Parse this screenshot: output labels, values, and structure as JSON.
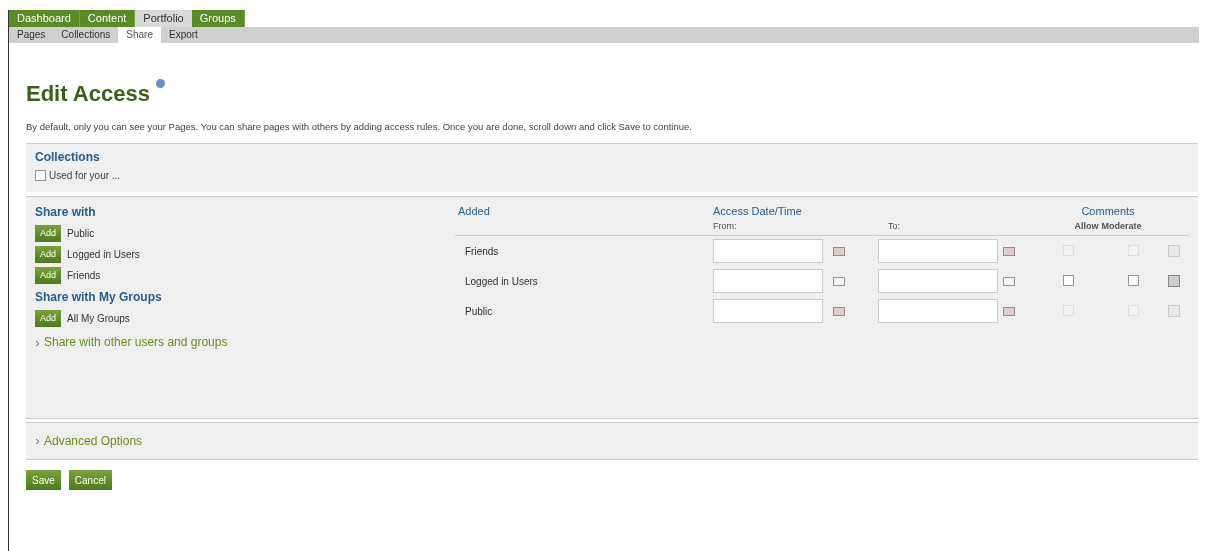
{
  "main_tabs": [
    {
      "label": "Dashboard",
      "selected": false
    },
    {
      "label": "Content",
      "selected": false
    },
    {
      "label": "Portfolio",
      "selected": true
    },
    {
      "label": "Groups",
      "selected": false
    }
  ],
  "sub_tabs": [
    {
      "label": "Pages",
      "selected": false
    },
    {
      "label": "Collections",
      "selected": false
    },
    {
      "label": "Share",
      "selected": true
    },
    {
      "label": "Export",
      "selected": false
    }
  ],
  "title": "Edit Access",
  "description": "By default, only you can see your Pages. You can share pages with others by adding access rules. Once you are done, scroll down and click Save to continue.",
  "collections": {
    "heading": "Collections",
    "option": {
      "label": "Used for your ...",
      "checked": false
    }
  },
  "share_with": {
    "heading": "Share with",
    "items": [
      {
        "button": "Add",
        "label": "Public"
      },
      {
        "button": "Add",
        "label": "Logged in Users"
      },
      {
        "button": "Add",
        "label": "Friends"
      }
    ]
  },
  "share_groups": {
    "heading": "Share with My Groups",
    "items": [
      {
        "button": "Add",
        "label": "All My Groups"
      }
    ]
  },
  "other_link": "Share with other users and groups",
  "table": {
    "added": "Added",
    "access": "Access Date/Time",
    "from": "From:",
    "to": "To:",
    "comments": "Comments",
    "allow": "Allow",
    "moderate": "Moderate",
    "rows": [
      {
        "name": "Friends",
        "disabled": true,
        "allow_comments": false,
        "moderate": false
      },
      {
        "name": "Logged in Users",
        "disabled": false,
        "allow_comments": false,
        "moderate": false
      },
      {
        "name": "Public",
        "disabled": true,
        "allow_comments": false,
        "moderate": false
      }
    ]
  },
  "advanced": "Advanced Options",
  "buttons": [
    "Save",
    "Cancel"
  ]
}
